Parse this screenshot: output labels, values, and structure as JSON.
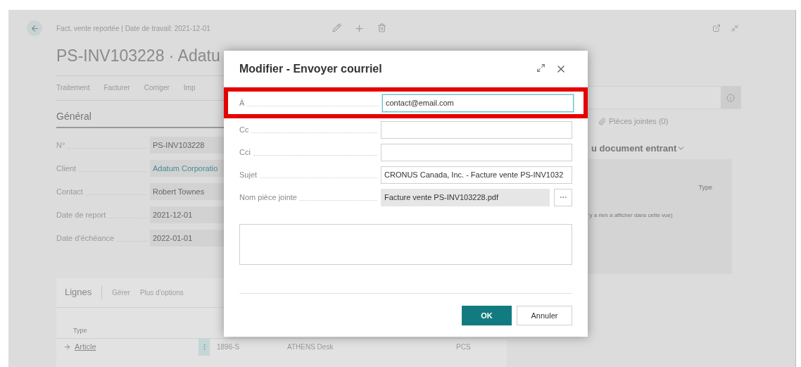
{
  "page": {
    "breadcrumb": "Fact. vente reportée | Date de travail: 2021-12-01",
    "title": "PS-INV103228 · Adatu",
    "actions": [
      "Traitement",
      "Facturer",
      "Corriger",
      "Imp"
    ],
    "section_title": "Général",
    "fields": [
      {
        "label": "N°",
        "value": "PS-INV103228",
        "kind": "text"
      },
      {
        "label": "Client",
        "value": "Adatum Corporatio",
        "kind": "link"
      },
      {
        "label": "Contact",
        "value": "Robert Townes",
        "kind": "text"
      },
      {
        "label": "Date de report",
        "value": "2021-12-01",
        "kind": "text"
      },
      {
        "label": "Date d'échéance",
        "value": "2022-01-01",
        "kind": "text"
      }
    ],
    "lines": {
      "title": "Lignes",
      "actions": [
        "Gérer",
        "Plus d'options"
      ],
      "column_1": "Type",
      "rows": [
        {
          "type": "Article",
          "no": "1896-S",
          "description": "ATHENS Desk",
          "unit": "PCS",
          "current": true
        }
      ]
    }
  },
  "factbox": {
    "attachments": "Pièces jointes (0)",
    "section_title": "u document entrant",
    "column": "Type",
    "empty_message": "'y a rien à afficher dans cette vue)"
  },
  "dialog": {
    "title": "Modifier - Envoyer courriel",
    "fields": [
      {
        "label": "À",
        "value": "contact@email.com",
        "kind": "input",
        "highlighted": true,
        "focused": true
      },
      {
        "label": "Cc",
        "kind": "input",
        "highlighted": false,
        "focused": false
      },
      {
        "label": "Cci",
        "kind": "input",
        "highlighted": false,
        "focused": false
      },
      {
        "label": "Sujet",
        "value": "CRONUS Canada, Inc. - Facture vente PS-INV1032",
        "kind": "input",
        "highlighted": false,
        "focused": false
      },
      {
        "label": "Nom pièce jointe",
        "value": "Facture vente PS-INV103228.pdf",
        "kind": "lookup",
        "highlighted": false,
        "focused": false
      }
    ],
    "buttons": [
      {
        "label": "OK",
        "primary": true
      },
      {
        "label": "Annuler",
        "primary": false
      }
    ]
  }
}
